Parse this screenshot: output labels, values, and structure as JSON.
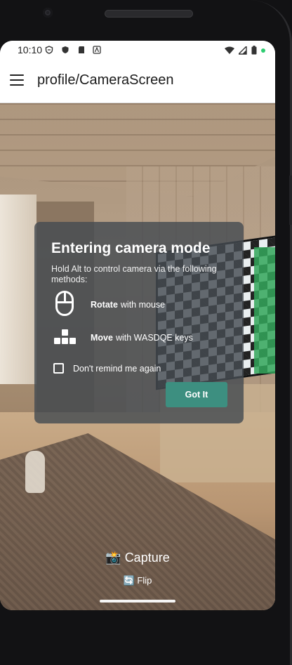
{
  "status_bar": {
    "time": "10:10",
    "left_icons": [
      "vpn-shield-icon",
      "shield-icon",
      "sd-card-icon",
      "notification-a-icon"
    ],
    "right_icons": [
      "wifi-icon",
      "signal-icon",
      "battery-icon"
    ],
    "indicator_color": "#2ecc71"
  },
  "app_bar": {
    "title": "profile/CameraScreen",
    "menu_icon": "hamburger-menu-icon"
  },
  "dialog": {
    "title": "Entering camera mode",
    "description": "Hold Alt to control camera via the following methods:",
    "rotate": {
      "bold": "Rotate",
      "text": "with mouse",
      "icon": "mouse-icon"
    },
    "move": {
      "bold": "Move",
      "text": "with WASDQE keys",
      "icon": "keyboard-keys-icon"
    },
    "checkbox_label": "Don't remind me again",
    "checkbox_checked": false,
    "button_label": "Got It",
    "button_color": "#3d8f80"
  },
  "controls": {
    "capture_label": "Capture",
    "capture_emoji": "📸",
    "flip_label": "Flip",
    "flip_emoji": "🔄"
  }
}
